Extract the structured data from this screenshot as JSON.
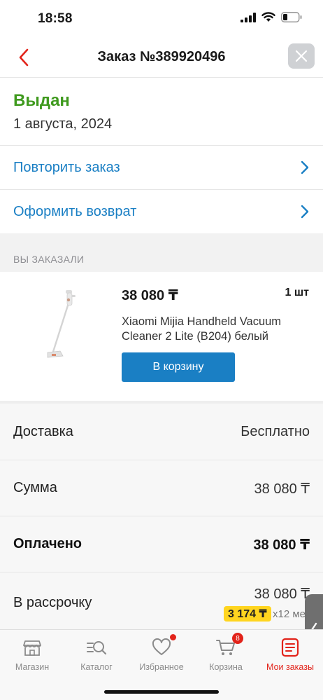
{
  "status_bar": {
    "time": "18:58"
  },
  "header": {
    "title": "Заказ №389920496"
  },
  "order": {
    "status": "Выдан",
    "date": "1 августа, 2024"
  },
  "actions": [
    {
      "label": "Повторить заказ"
    },
    {
      "label": "Оформить возврат"
    }
  ],
  "ordered_section": {
    "title": "ВЫ ЗАКАЗАЛИ"
  },
  "product": {
    "price": "38 080 ₸",
    "quantity": "1 шт",
    "name": "Xiaomi Mijia Handheld Vacuum Cleaner 2 Lite (B204) белый",
    "cart_button": "В корзину"
  },
  "summary": {
    "delivery": {
      "label": "Доставка",
      "value": "Бесплатно"
    },
    "total": {
      "label": "Сумма",
      "value": "38 080 ₸"
    },
    "paid": {
      "label": "Оплачено",
      "value": "38 080 ₸"
    },
    "installment": {
      "label": "В рассрочку",
      "value": "38 080 ₸",
      "monthly": "3 174 ₸",
      "term": "x12 ме"
    }
  },
  "tab_bar": {
    "items": [
      {
        "label": "Магазин",
        "icon": "shop-icon"
      },
      {
        "label": "Каталог",
        "icon": "catalog-search-icon"
      },
      {
        "label": "Избранное",
        "icon": "heart-icon"
      },
      {
        "label": "Корзина",
        "icon": "cart-icon",
        "badge": "8"
      },
      {
        "label": "Мои заказы",
        "icon": "orders-icon"
      }
    ]
  },
  "colors": {
    "accent_blue": "#1a7fc4",
    "status_green": "#3f9a1e",
    "brand_red": "#e2231a",
    "installment_yellow": "#ffd51f"
  }
}
